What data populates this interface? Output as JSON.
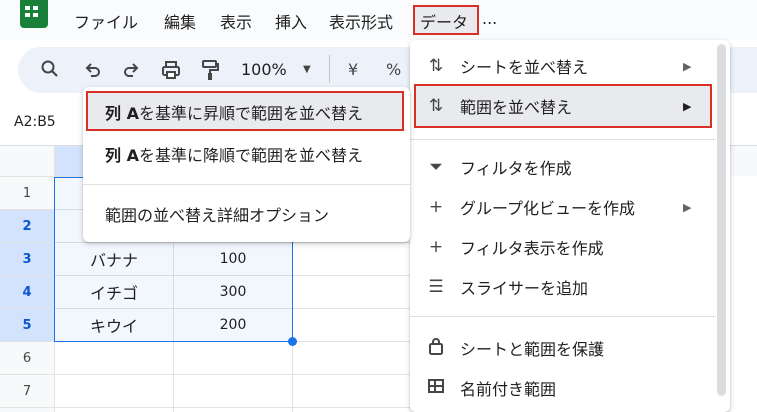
{
  "menubar": {
    "items": [
      "ファイル",
      "編集",
      "表示",
      "挿入",
      "表示形式",
      "データ"
    ],
    "overflow": "..."
  },
  "toolbar": {
    "icons": [
      "search-icon",
      "undo-icon",
      "redo-icon",
      "print-icon",
      "paint-format-icon"
    ],
    "zoom": "100%",
    "currency_symbol": "¥",
    "percent_symbol": "%"
  },
  "namebox": {
    "value": "A2:B5"
  },
  "grid": {
    "row_numbers": [
      "1",
      "2",
      "3",
      "4",
      "5",
      "6",
      "7"
    ],
    "rows": [
      {
        "a": "",
        "b": ""
      },
      {
        "a": "",
        "b": ""
      },
      {
        "a": "バナナ",
        "b": "100"
      },
      {
        "a": "イチゴ",
        "b": "300"
      },
      {
        "a": "キウイ",
        "b": "200"
      },
      {
        "a": "",
        "b": ""
      },
      {
        "a": "",
        "b": ""
      }
    ]
  },
  "data_menu": {
    "items": [
      {
        "icon": "sort-icon",
        "label": "シートを並べ替え",
        "submenu": true
      },
      {
        "icon": "sort-icon",
        "label": "範囲を並べ替え",
        "submenu": true,
        "highlighted": true
      },
      {
        "icon": "filter-icon",
        "label": "フィルタを作成",
        "submenu": false
      },
      {
        "icon": "plus-icon",
        "label": "グループ化ビューを作成",
        "submenu": true
      },
      {
        "icon": "plus-icon",
        "label": "フィルタ表示を作成",
        "submenu": false
      },
      {
        "icon": "slicer-icon",
        "label": "スライサーを追加",
        "submenu": false
      },
      {
        "icon": "lock-icon",
        "label": "シートと範囲を保護",
        "submenu": false
      },
      {
        "icon": "named-range-icon",
        "label": "名前付き範囲",
        "submenu": false
      }
    ]
  },
  "sort_submenu": {
    "items": [
      {
        "bold": "列 A",
        "label": " を基準に昇順で範囲を並べ替え",
        "highlighted": true
      },
      {
        "bold": "列 A",
        "label": " を基準に降順で範囲を並べ替え",
        "highlighted": false
      },
      {
        "bold": "",
        "label": "範囲の並べ替え詳細オプション",
        "highlighted": false
      }
    ]
  },
  "colors": {
    "accent": "#1a73e8",
    "highlight_box": "#d93025",
    "sheets_green": "#188038"
  }
}
